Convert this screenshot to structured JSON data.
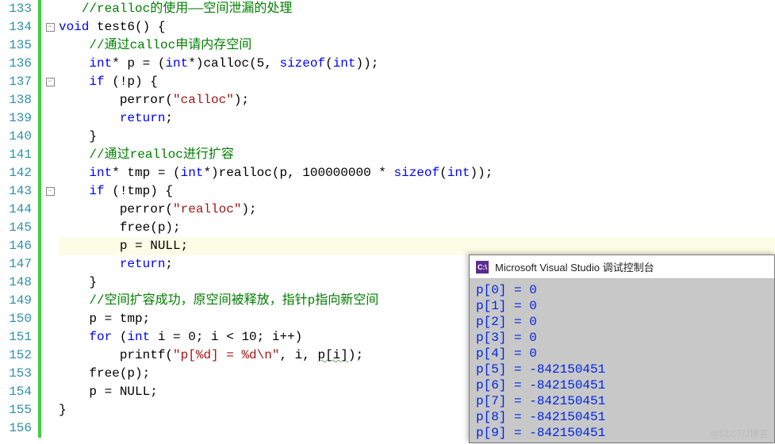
{
  "editor": {
    "first_line_number": 133,
    "highlight_line": 146,
    "lines": [
      {
        "fold": "",
        "segs": [
          {
            "cls": "c-default",
            "t": "   "
          },
          {
            "cls": "c-comment",
            "t": "//realloc的使用——空间泄漏的处理"
          }
        ]
      },
      {
        "fold": "minus",
        "segs": [
          {
            "cls": "c-keyword",
            "t": "void"
          },
          {
            "cls": "c-default",
            "t": " test6() {"
          }
        ]
      },
      {
        "fold": "",
        "segs": [
          {
            "cls": "c-default",
            "t": "    "
          },
          {
            "cls": "c-comment",
            "t": "//通过calloc申请内存空间"
          }
        ]
      },
      {
        "fold": "",
        "segs": [
          {
            "cls": "c-default",
            "t": "    "
          },
          {
            "cls": "c-keyword",
            "t": "int"
          },
          {
            "cls": "c-default",
            "t": "* p = ("
          },
          {
            "cls": "c-keyword",
            "t": "int"
          },
          {
            "cls": "c-default",
            "t": "*)calloc(5, "
          },
          {
            "cls": "c-keyword",
            "t": "sizeof"
          },
          {
            "cls": "c-default",
            "t": "("
          },
          {
            "cls": "c-keyword",
            "t": "int"
          },
          {
            "cls": "c-default",
            "t": "));"
          }
        ]
      },
      {
        "fold": "minus",
        "segs": [
          {
            "cls": "c-default",
            "t": "    "
          },
          {
            "cls": "c-keyword",
            "t": "if"
          },
          {
            "cls": "c-default",
            "t": " (!p) {"
          }
        ]
      },
      {
        "fold": "",
        "segs": [
          {
            "cls": "c-default",
            "t": "        perror("
          },
          {
            "cls": "c-string",
            "t": "\"calloc\""
          },
          {
            "cls": "c-default",
            "t": ");"
          }
        ]
      },
      {
        "fold": "",
        "segs": [
          {
            "cls": "c-default",
            "t": "        "
          },
          {
            "cls": "c-keyword",
            "t": "return"
          },
          {
            "cls": "c-default",
            "t": ";"
          }
        ]
      },
      {
        "fold": "",
        "segs": [
          {
            "cls": "c-default",
            "t": "    }"
          }
        ]
      },
      {
        "fold": "",
        "segs": [
          {
            "cls": "c-default",
            "t": "    "
          },
          {
            "cls": "c-comment",
            "t": "//通过realloc进行扩容"
          }
        ]
      },
      {
        "fold": "",
        "segs": [
          {
            "cls": "c-default",
            "t": "    "
          },
          {
            "cls": "c-keyword",
            "t": "int"
          },
          {
            "cls": "c-default",
            "t": "* tmp = ("
          },
          {
            "cls": "c-keyword",
            "t": "int"
          },
          {
            "cls": "c-default",
            "t": "*)realloc(p, 100000000 * "
          },
          {
            "cls": "c-keyword",
            "t": "sizeof"
          },
          {
            "cls": "c-default",
            "t": "("
          },
          {
            "cls": "c-keyword",
            "t": "int"
          },
          {
            "cls": "c-default",
            "t": "));"
          }
        ]
      },
      {
        "fold": "minus",
        "segs": [
          {
            "cls": "c-default",
            "t": "    "
          },
          {
            "cls": "c-keyword",
            "t": "if"
          },
          {
            "cls": "c-default",
            "t": " (!tmp) {"
          }
        ]
      },
      {
        "fold": "",
        "segs": [
          {
            "cls": "c-default",
            "t": "        perror("
          },
          {
            "cls": "c-string",
            "t": "\"realloc\""
          },
          {
            "cls": "c-default",
            "t": ");"
          }
        ]
      },
      {
        "fold": "",
        "segs": [
          {
            "cls": "c-default",
            "t": "        free(p);"
          }
        ]
      },
      {
        "fold": "",
        "segs": [
          {
            "cls": "c-default",
            "t": "        p = NULL;"
          }
        ]
      },
      {
        "fold": "",
        "segs": [
          {
            "cls": "c-default",
            "t": "        "
          },
          {
            "cls": "c-keyword",
            "t": "return"
          },
          {
            "cls": "c-default",
            "t": ";"
          }
        ]
      },
      {
        "fold": "",
        "segs": [
          {
            "cls": "c-default",
            "t": "    }"
          }
        ]
      },
      {
        "fold": "",
        "segs": [
          {
            "cls": "c-default",
            "t": "    "
          },
          {
            "cls": "c-comment",
            "t": "//空间扩容成功，原空间被释放，指针p指向新空间"
          }
        ]
      },
      {
        "fold": "",
        "segs": [
          {
            "cls": "c-default",
            "t": "    p = tmp;"
          }
        ]
      },
      {
        "fold": "",
        "segs": [
          {
            "cls": "c-default",
            "t": "    "
          },
          {
            "cls": "c-keyword",
            "t": "for"
          },
          {
            "cls": "c-default",
            "t": " ("
          },
          {
            "cls": "c-keyword",
            "t": "int"
          },
          {
            "cls": "c-default",
            "t": " i = 0; i < 10; i++)"
          }
        ]
      },
      {
        "fold": "",
        "segs": [
          {
            "cls": "c-default",
            "t": "        printf("
          },
          {
            "cls": "c-string",
            "t": "\"p[%d] = %d\\n\""
          },
          {
            "cls": "c-default",
            "t": ", i, "
          },
          {
            "cls": "c-default squiggle",
            "t": "p[i]"
          },
          {
            "cls": "c-default",
            "t": ");"
          }
        ]
      },
      {
        "fold": "",
        "segs": [
          {
            "cls": "c-default",
            "t": "    free(p);"
          }
        ]
      },
      {
        "fold": "",
        "segs": [
          {
            "cls": "c-default",
            "t": "    p = NULL;"
          }
        ]
      },
      {
        "fold": "",
        "segs": [
          {
            "cls": "c-default",
            "t": "}"
          }
        ]
      },
      {
        "fold": "",
        "segs": [
          {
            "cls": "c-default",
            "t": ""
          }
        ]
      }
    ]
  },
  "console": {
    "title": "Microsoft Visual Studio 调试控制台",
    "icon_text": "C:\\",
    "lines": [
      "p[0] = 0",
      "p[1] = 0",
      "p[2] = 0",
      "p[3] = 0",
      "p[4] = 0",
      "p[5] = -842150451",
      "p[6] = -842150451",
      "p[7] = -842150451",
      "p[8] = -842150451",
      "p[9] = -842150451"
    ]
  },
  "watermark": "@51CTO博客"
}
